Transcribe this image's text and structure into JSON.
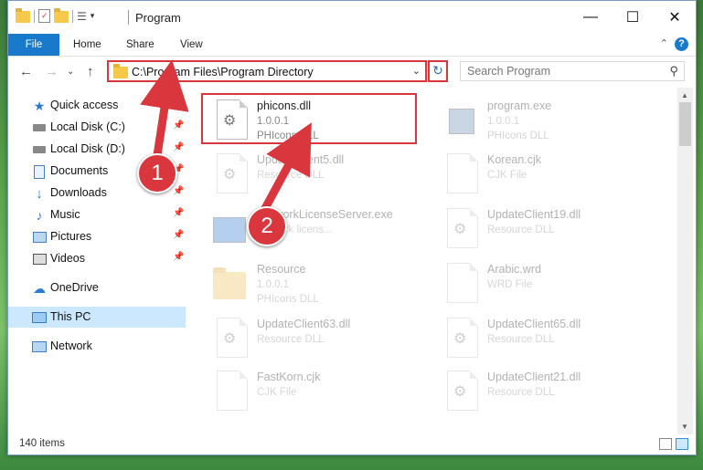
{
  "window": {
    "title": "Program",
    "controls": {
      "minimize": "—",
      "maximize": "☐",
      "close": "✕"
    }
  },
  "ribbon": {
    "tabs": [
      "File",
      "Home",
      "Share",
      "View"
    ],
    "help": "?"
  },
  "address": {
    "path": "C:\\Program Files\\Program Directory",
    "search_placeholder": "Search Program"
  },
  "nav": {
    "items": [
      {
        "label": "Quick access",
        "icon": "star-icon"
      },
      {
        "label": "Local Disk (C:)",
        "icon": "drive-icon"
      },
      {
        "label": "Local Disk (D:)",
        "icon": "drive-icon"
      },
      {
        "label": "Documents",
        "icon": "documents-icon"
      },
      {
        "label": "Downloads",
        "icon": "download-icon"
      },
      {
        "label": "Music",
        "icon": "music-icon"
      },
      {
        "label": "Pictures",
        "icon": "pictures-icon"
      },
      {
        "label": "Videos",
        "icon": "videos-icon"
      },
      {
        "label": "OneDrive",
        "icon": "cloud-icon"
      },
      {
        "label": "This PC",
        "icon": "pc-icon"
      },
      {
        "label": "Network",
        "icon": "network-icon"
      }
    ]
  },
  "files": [
    {
      "name": "phicons.dll",
      "line1": "1.0.0.1",
      "line2": "PHIcons DLL"
    },
    {
      "name": "program.exe",
      "line1": "1.0.0.1",
      "line2": "PHIcons DLL"
    },
    {
      "name": "UpdateClient5.dll",
      "line1": "Resource DLL",
      "line2": ""
    },
    {
      "name": "Korean.cjk",
      "line1": "CJK File",
      "line2": ""
    },
    {
      "name": "NetworkLicenseServer.exe",
      "line1": "network licens...",
      "line2": ""
    },
    {
      "name": "UpdateClient19.dll",
      "line1": "Resource DLL",
      "line2": ""
    },
    {
      "name": "Resource",
      "line1": "1.0.0.1",
      "line2": "PHIcons DLL"
    },
    {
      "name": "Arabic.wrd",
      "line1": "WRD File",
      "line2": ""
    },
    {
      "name": "UpdateClient63.dll",
      "line1": "Resource DLL",
      "line2": ""
    },
    {
      "name": "UpdateClient65.dll",
      "line1": "Resource DLL",
      "line2": ""
    },
    {
      "name": "FastKorn.cjk",
      "line1": "CJK File",
      "line2": ""
    },
    {
      "name": "UpdateClient21.dll",
      "line1": "Resource DLL",
      "line2": ""
    }
  ],
  "status": {
    "count": "140 items"
  },
  "annotations": {
    "badge1": "1",
    "badge2": "2"
  },
  "colors": {
    "accent": "#1979ca",
    "highlight": "#d9363e",
    "selected": "#cce8ff"
  }
}
